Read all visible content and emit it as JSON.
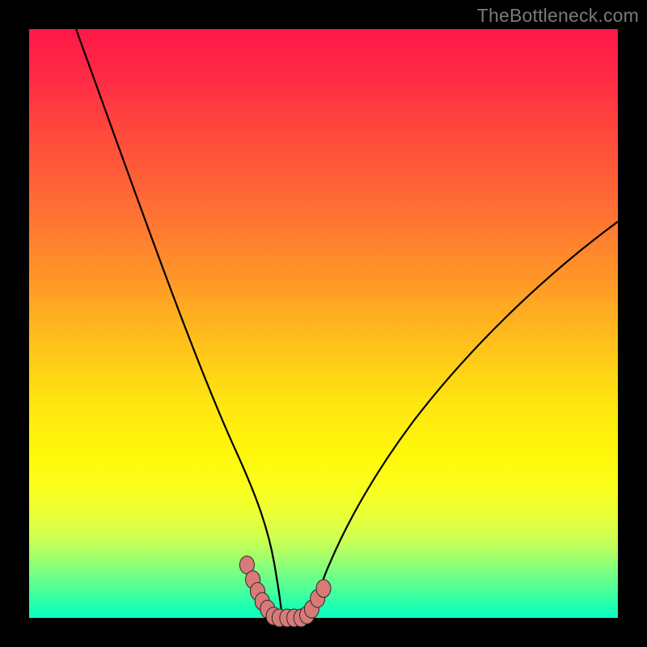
{
  "watermark": "TheBottleneck.com",
  "colors": {
    "frame": "#000000",
    "watermark": "#7a7a7a",
    "curve_stroke": "#000000",
    "marker_fill": "#d87a78",
    "marker_stroke": "#2b2b2b"
  },
  "chart_data": {
    "type": "line",
    "title": "",
    "xlabel": "",
    "ylabel": "",
    "xlim": [
      0,
      100
    ],
    "ylim": [
      0,
      100
    ],
    "grid": false,
    "legend": false,
    "series": [
      {
        "name": "left-branch",
        "x": [
          8,
          12,
          16,
          20,
          24,
          27,
          30,
          33,
          35,
          37,
          38.5,
          40,
          41,
          42
        ],
        "y": [
          100,
          88,
          76,
          64,
          52,
          41,
          31,
          22,
          15,
          9,
          5,
          2.5,
          0.8,
          0
        ]
      },
      {
        "name": "right-branch",
        "x": [
          46,
          47,
          48.5,
          50,
          52,
          55,
          59,
          64,
          70,
          77,
          85,
          94,
          100
        ],
        "y": [
          0,
          0.8,
          2.5,
          5,
          9,
          14,
          20,
          27,
          35,
          43,
          52,
          61,
          67
        ]
      },
      {
        "name": "valley-floor",
        "x": [
          42,
          43,
          44,
          45,
          46
        ],
        "y": [
          0,
          0,
          0,
          0,
          0
        ]
      }
    ],
    "markers": [
      {
        "series": "left-branch",
        "x": 37.0,
        "y": 9.0
      },
      {
        "series": "left-branch",
        "x": 38.0,
        "y": 6.5
      },
      {
        "series": "left-branch",
        "x": 38.8,
        "y": 4.5
      },
      {
        "series": "left-branch",
        "x": 39.6,
        "y": 2.8
      },
      {
        "series": "left-branch",
        "x": 40.5,
        "y": 1.5
      },
      {
        "series": "valley-floor",
        "x": 41.5,
        "y": 0.3
      },
      {
        "series": "valley-floor",
        "x": 42.5,
        "y": 0.0
      },
      {
        "series": "valley-floor",
        "x": 43.8,
        "y": 0.0
      },
      {
        "series": "valley-floor",
        "x": 45.0,
        "y": 0.0
      },
      {
        "series": "valley-floor",
        "x": 46.2,
        "y": 0.0
      },
      {
        "series": "right-branch",
        "x": 47.2,
        "y": 0.5
      },
      {
        "series": "right-branch",
        "x": 48.0,
        "y": 1.5
      },
      {
        "series": "right-branch",
        "x": 49.0,
        "y": 3.3
      },
      {
        "series": "right-branch",
        "x": 50.0,
        "y": 5.0
      }
    ]
  }
}
